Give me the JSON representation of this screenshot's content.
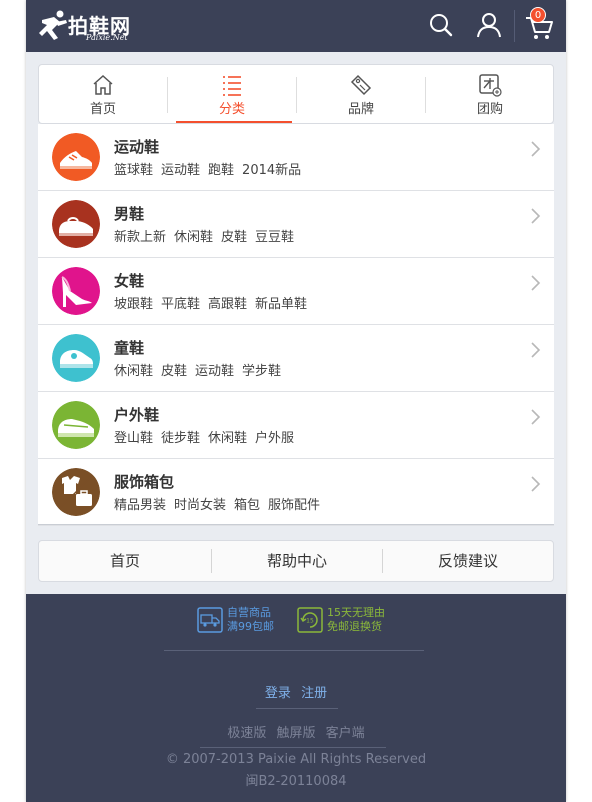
{
  "header": {
    "logo_text": "拍鞋网",
    "logo_sub": "Paixie.Net",
    "cart_count": "0"
  },
  "nav": {
    "tabs": [
      {
        "label": "首页",
        "icon": "home-icon"
      },
      {
        "label": "分类",
        "icon": "list-icon",
        "active": true
      },
      {
        "label": "品牌",
        "icon": "tag-icon"
      },
      {
        "label": "团购",
        "icon": "group-buy-icon"
      }
    ]
  },
  "categories": [
    {
      "name": "运动鞋",
      "color": "#f15a24",
      "subs": [
        "篮球鞋",
        "运动鞋",
        "跑鞋",
        "2014新品"
      ]
    },
    {
      "name": "男鞋",
      "color": "#a8321f",
      "subs": [
        "新款上新",
        "休闲鞋",
        "皮鞋",
        "豆豆鞋"
      ]
    },
    {
      "name": "女鞋",
      "color": "#e0148c",
      "subs": [
        "坡跟鞋",
        "平底鞋",
        "高跟鞋",
        "新品单鞋"
      ]
    },
    {
      "name": "童鞋",
      "color": "#3ec1cf",
      "subs": [
        "休闲鞋",
        "皮鞋",
        "运动鞋",
        "学步鞋"
      ]
    },
    {
      "name": "户外鞋",
      "color": "#7bb534",
      "subs": [
        "登山鞋",
        "徒步鞋",
        "休闲鞋",
        "户外服"
      ]
    },
    {
      "name": "服饰箱包",
      "color": "#7a4f26",
      "subs": [
        "精品男装",
        "时尚女装",
        "箱包",
        "服饰配件"
      ]
    }
  ],
  "bottom_nav": [
    "首页",
    "帮助中心",
    "反馈建议"
  ],
  "footer": {
    "promo1": {
      "line1": "自营商品",
      "line2": "满99包邮",
      "color": "#5a9be0"
    },
    "promo2": {
      "line1": "15天无理由",
      "line2": "免邮退换货",
      "color": "#8bb83a"
    },
    "login": "登录",
    "register": "注册",
    "versions": [
      "极速版",
      "触屏版",
      "客户端"
    ],
    "copyright": "© 2007-2013 Paixie All Rights Reserved",
    "icp": "闽B2-20110084"
  }
}
